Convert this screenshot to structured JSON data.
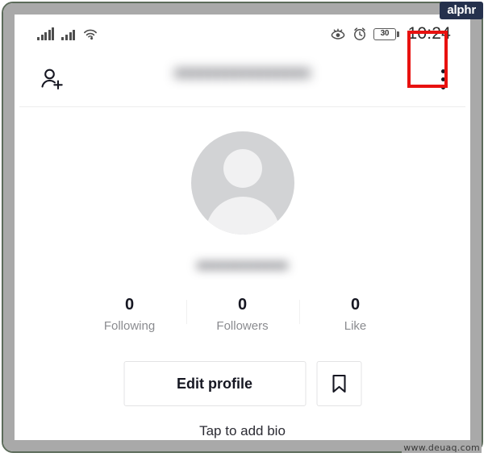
{
  "frame": {
    "brand_badge": "alphr",
    "watermark": "www.deuaq.com"
  },
  "status_bar": {
    "time": "10:24",
    "battery_level": "30",
    "icons": [
      "signal-bars-icon",
      "signal-bars-secondary-icon",
      "wifi-icon",
      "eye-care-icon",
      "alarm-clock-icon",
      "battery-icon"
    ]
  },
  "app_bar": {
    "add_person_icon": "add-person-icon",
    "username": "xxxxxxxxxxxxxxxx",
    "more_icon": "more-vertical-icon",
    "highlight_color": "#e8110f"
  },
  "profile": {
    "avatar_icon": "default-avatar-icon",
    "display_name": "xxxxxxxxxxxx",
    "stats": [
      {
        "value": "0",
        "label": "Following"
      },
      {
        "value": "0",
        "label": "Followers"
      },
      {
        "value": "0",
        "label": "Like"
      }
    ],
    "edit_profile_label": "Edit profile",
    "bookmark_icon": "bookmark-icon",
    "bio_hint": "Tap to add bio"
  }
}
